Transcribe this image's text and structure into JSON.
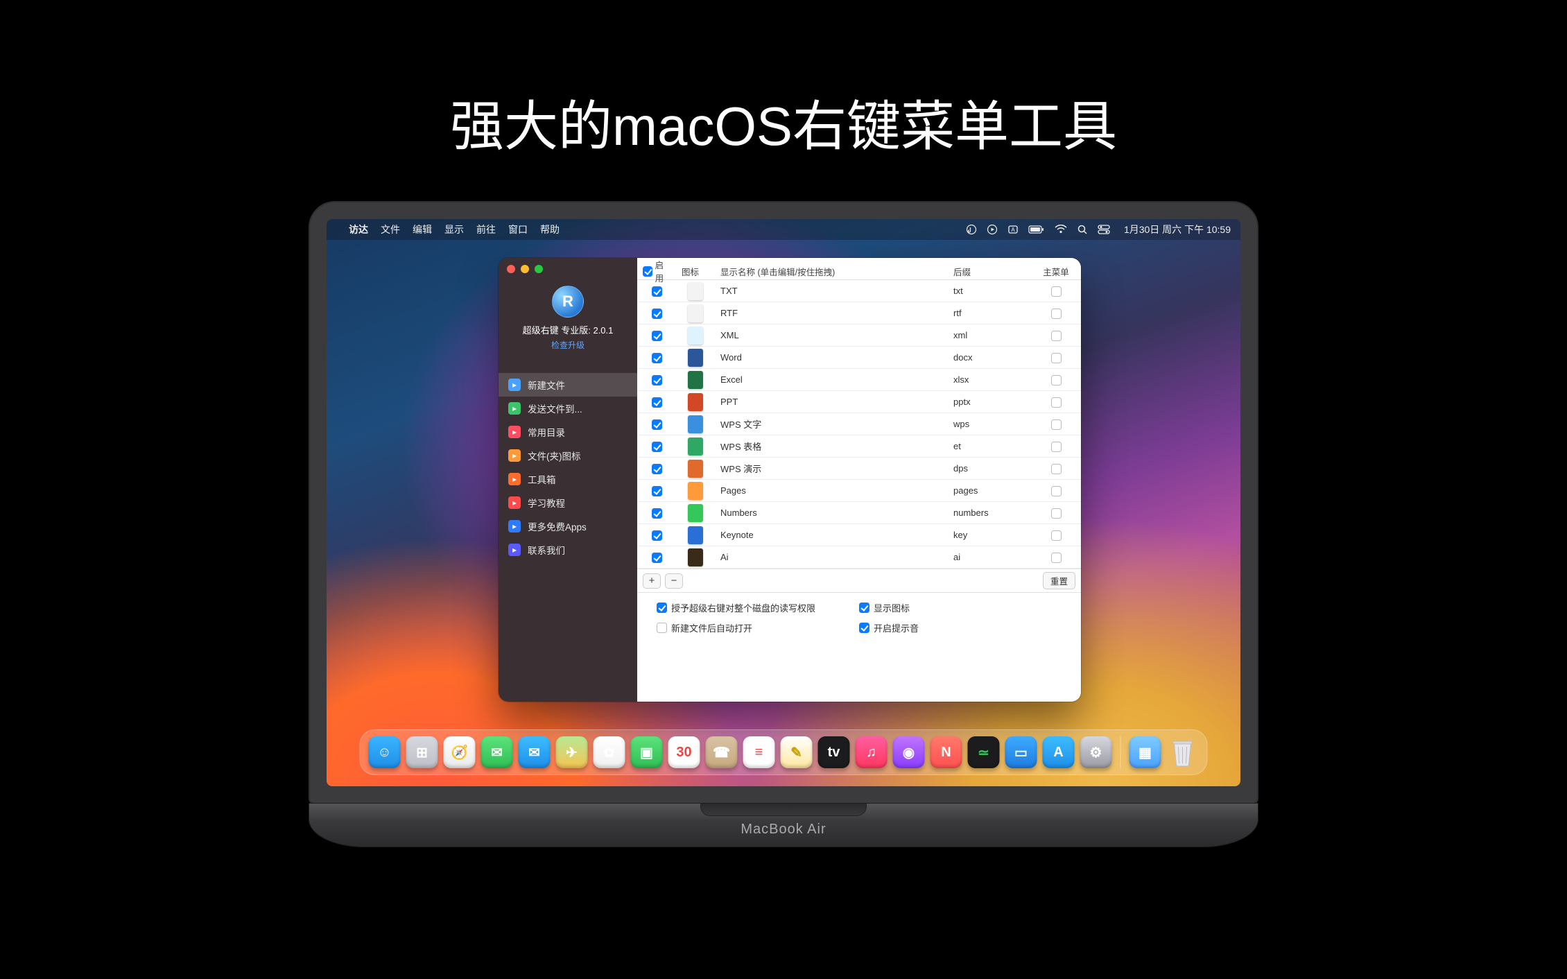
{
  "headline": "强大的macOS右键菜单工具",
  "laptop_label": "MacBook Air",
  "menubar": {
    "app": "访达",
    "items": [
      "文件",
      "编辑",
      "显示",
      "前往",
      "窗口",
      "帮助"
    ],
    "clock": "1月30日 周六 下午 10:59",
    "status_icons": [
      "music-icon",
      "play-icon",
      "input-icon",
      "battery-icon",
      "wifi-icon",
      "search-icon",
      "control-center-icon"
    ]
  },
  "window": {
    "brand_title": "超级右键 专业版: 2.0.1",
    "check_update": "检查升级",
    "logo_letter": "R",
    "nav": [
      {
        "label": "新建文件",
        "icon_bg": "#4aa2ff",
        "active": true
      },
      {
        "label": "发送文件到...",
        "icon_bg": "#3cc46a"
      },
      {
        "label": "常用目录",
        "icon_bg": "#ff4d62"
      },
      {
        "label": "文件(夹)图标",
        "icon_bg": "#ff9a3a"
      },
      {
        "label": "工具箱",
        "icon_bg": "#ff6b2d"
      },
      {
        "label": "学习教程",
        "icon_bg": "#ff4b4b"
      },
      {
        "label": "更多免费Apps",
        "icon_bg": "#2f7bff"
      },
      {
        "label": "联系我们",
        "icon_bg": "#5a5aff"
      }
    ],
    "columns": {
      "enable": "启用",
      "icon": "图标",
      "name": "显示名称 (单击编辑/按住拖拽)",
      "ext": "后缀",
      "mainmenu": "主菜单"
    },
    "rows": [
      {
        "enabled": true,
        "name": "TXT",
        "ext": "txt",
        "main": false,
        "icon": "#f3f3f3"
      },
      {
        "enabled": true,
        "name": "RTF",
        "ext": "rtf",
        "main": false,
        "icon": "#f3f3f3"
      },
      {
        "enabled": true,
        "name": "XML",
        "ext": "xml",
        "main": false,
        "icon": "#dff3ff"
      },
      {
        "enabled": true,
        "name": "Word",
        "ext": "docx",
        "main": false,
        "icon": "#2b579a"
      },
      {
        "enabled": true,
        "name": "Excel",
        "ext": "xlsx",
        "main": false,
        "icon": "#217346"
      },
      {
        "enabled": true,
        "name": "PPT",
        "ext": "pptx",
        "main": false,
        "icon": "#d24726"
      },
      {
        "enabled": true,
        "name": "WPS 文字",
        "ext": "wps",
        "main": false,
        "icon": "#3a8fde"
      },
      {
        "enabled": true,
        "name": "WPS 表格",
        "ext": "et",
        "main": false,
        "icon": "#2fa866"
      },
      {
        "enabled": true,
        "name": "WPS 演示",
        "ext": "dps",
        "main": false,
        "icon": "#e06a2b"
      },
      {
        "enabled": true,
        "name": "Pages",
        "ext": "pages",
        "main": false,
        "icon": "#ff9a3a"
      },
      {
        "enabled": true,
        "name": "Numbers",
        "ext": "numbers",
        "main": false,
        "icon": "#34c759"
      },
      {
        "enabled": true,
        "name": "Keynote",
        "ext": "key",
        "main": false,
        "icon": "#2a6fd6"
      },
      {
        "enabled": true,
        "name": "Ai",
        "ext": "ai",
        "main": false,
        "icon": "#3a2a1a"
      }
    ],
    "buttons": {
      "add": "+",
      "remove": "−",
      "reset": "重置"
    },
    "options": {
      "grant": {
        "label": "授予超级右键对整个磁盘的读写权限",
        "checked": true
      },
      "showicon": {
        "label": "显示图标",
        "checked": true
      },
      "autoopen": {
        "label": "新建文件后自动打开",
        "checked": false
      },
      "sound": {
        "label": "开启提示音",
        "checked": true
      }
    }
  },
  "dock": [
    {
      "name": "finder",
      "bg": "linear-gradient(#3bb5ff,#1e8fe8)",
      "glyph": "☺"
    },
    {
      "name": "launchpad",
      "bg": "linear-gradient(#d7d7df,#bfbfc7)",
      "glyph": "⊞"
    },
    {
      "name": "safari",
      "bg": "linear-gradient(#fff,#eaeaea)",
      "glyph": "🧭"
    },
    {
      "name": "messages",
      "bg": "linear-gradient(#5ce27a,#2fbe55)",
      "glyph": "✉"
    },
    {
      "name": "mail",
      "bg": "linear-gradient(#3dbcff,#1e8fe8)",
      "glyph": "✉"
    },
    {
      "name": "maps",
      "bg": "linear-gradient(#b8e994,#f6c453)",
      "glyph": "✈"
    },
    {
      "name": "photos",
      "bg": "linear-gradient(#fff,#f0f0f0)",
      "glyph": "✿"
    },
    {
      "name": "facetime",
      "bg": "linear-gradient(#5ce27a,#2fbe55)",
      "glyph": "▣"
    },
    {
      "name": "calendar",
      "bg": "#fff",
      "glyph": "30",
      "text": "#e44"
    },
    {
      "name": "contacts",
      "bg": "linear-gradient(#d9c2a4,#c7a97f)",
      "glyph": "☎"
    },
    {
      "name": "reminders",
      "bg": "#fff",
      "glyph": "≡",
      "text": "#e44"
    },
    {
      "name": "notes",
      "bg": "linear-gradient(#fff,#ffe8a0)",
      "glyph": "✎",
      "text": "#c8a000"
    },
    {
      "name": "tv",
      "bg": "#1c1c1e",
      "glyph": "tv"
    },
    {
      "name": "music",
      "bg": "linear-gradient(#ff5ea0,#ff375f)",
      "glyph": "♫"
    },
    {
      "name": "podcasts",
      "bg": "linear-gradient(#c074ff,#8a3dff)",
      "glyph": "◉"
    },
    {
      "name": "news",
      "bg": "linear-gradient(#ff7a6a,#ff5050)",
      "glyph": "N"
    },
    {
      "name": "stocks",
      "bg": "#1c1c1e",
      "glyph": "≃",
      "text": "#34c759"
    },
    {
      "name": "keynote",
      "bg": "linear-gradient(#3daaff,#1f7de0)",
      "glyph": "▭"
    },
    {
      "name": "appstore",
      "bg": "linear-gradient(#3dbcff,#1e8fe8)",
      "glyph": "A"
    },
    {
      "name": "settings",
      "bg": "linear-gradient(#d7d7df,#9a9aa2)",
      "glyph": "⚙"
    }
  ],
  "dock_right": [
    {
      "name": "recent-folder",
      "bg": "linear-gradient(#7ecbff,#4aa2ff)",
      "glyph": "▦"
    },
    {
      "name": "trash",
      "glyph": ""
    }
  ]
}
